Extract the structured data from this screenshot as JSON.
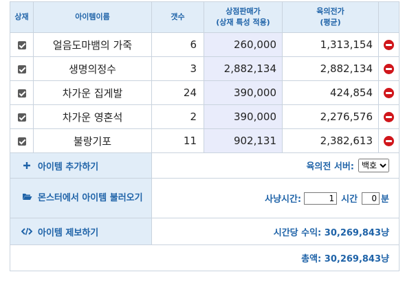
{
  "headers": {
    "check": "상재",
    "name": "아이템이름",
    "qty": "갯수",
    "price_line1": "상점판매가",
    "price_line2": "(상재 특성 적용)",
    "avg_line1": "육의전가",
    "avg_line2": "(평균)"
  },
  "items": [
    {
      "name": "얼음도마뱀의 가죽",
      "qty": "6",
      "price": "260,000",
      "avg": "1,313,154"
    },
    {
      "name": "생명의정수",
      "qty": "3",
      "price": "2,882,134",
      "avg": "2,882,134"
    },
    {
      "name": "차가운 집게발",
      "qty": "24",
      "price": "390,000",
      "avg": "424,854"
    },
    {
      "name": "차가운 영혼석",
      "qty": "2",
      "price": "390,000",
      "avg": "2,276,576"
    },
    {
      "name": "불랑기포",
      "qty": "11",
      "price": "902,131",
      "avg": "2,382,613"
    }
  ],
  "actions": {
    "add_item": "아이템 추가하기",
    "load_from_monster": "몬스터에서 아이템 불러오기",
    "report_item": "아이템 제보하기"
  },
  "icons": {
    "add": "plus-icon",
    "load": "folder-open-icon",
    "report": "code-icon",
    "remove": "remove-icon"
  },
  "server": {
    "label": "육의전 서버:",
    "selected": "백호"
  },
  "hunt": {
    "label": "사냥시간:",
    "hours_value": "1",
    "hours_unit": "시간",
    "minutes_value": "0",
    "minutes_unit": "분"
  },
  "income": {
    "hourly": "시간당 수익: 30,269,843냥",
    "total": "총액: 30,269,843냥"
  },
  "colors": {
    "accent": "#1f63a8",
    "header_bg": "#e1edf8",
    "price_bg": "#e9ecfb",
    "remove": "#d0161b"
  }
}
